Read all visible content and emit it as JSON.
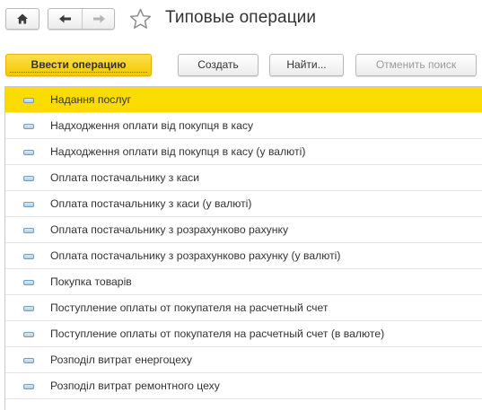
{
  "window": {
    "title": "Типовые операции"
  },
  "toolbar": {
    "enter_operation_label": "Ввести операцию",
    "create_label": "Создать",
    "find_label": "Найти...",
    "cancel_search_label": "Отменить поиск"
  },
  "icons": {
    "home": "home-icon",
    "back": "arrow-left-icon",
    "forward": "arrow-right-icon",
    "favorite": "star-icon",
    "row_marker": "operation-item-icon"
  },
  "colors": {
    "accent_yellow": "#fbdc00",
    "enter_button_yellow": "#f6ce0c",
    "row_marker_blue": "#6f9cbf"
  },
  "list": {
    "selected_index": 0,
    "items": [
      {
        "label": "Надання послуг"
      },
      {
        "label": "Надходження оплати від покупця в касу"
      },
      {
        "label": "Надходження оплати від покупця в касу (у валюті)"
      },
      {
        "label": "Оплата постачальнику з каси"
      },
      {
        "label": "Оплата постачальнику з каси (у валюті)"
      },
      {
        "label": "Оплата постачальнику з розрахунково рахунку"
      },
      {
        "label": "Оплата постачальнику з розрахунково рахунку (у валюті)"
      },
      {
        "label": "Покупка товарів"
      },
      {
        "label": "Поступление оплаты от покупателя на расчетный счет"
      },
      {
        "label": "Поступление оплаты от покупателя на расчетный счет (в валюте)"
      },
      {
        "label": "Розподіл витрат енергоцеху"
      },
      {
        "label": "Розподіл витрат ремонтного цеху"
      }
    ]
  }
}
